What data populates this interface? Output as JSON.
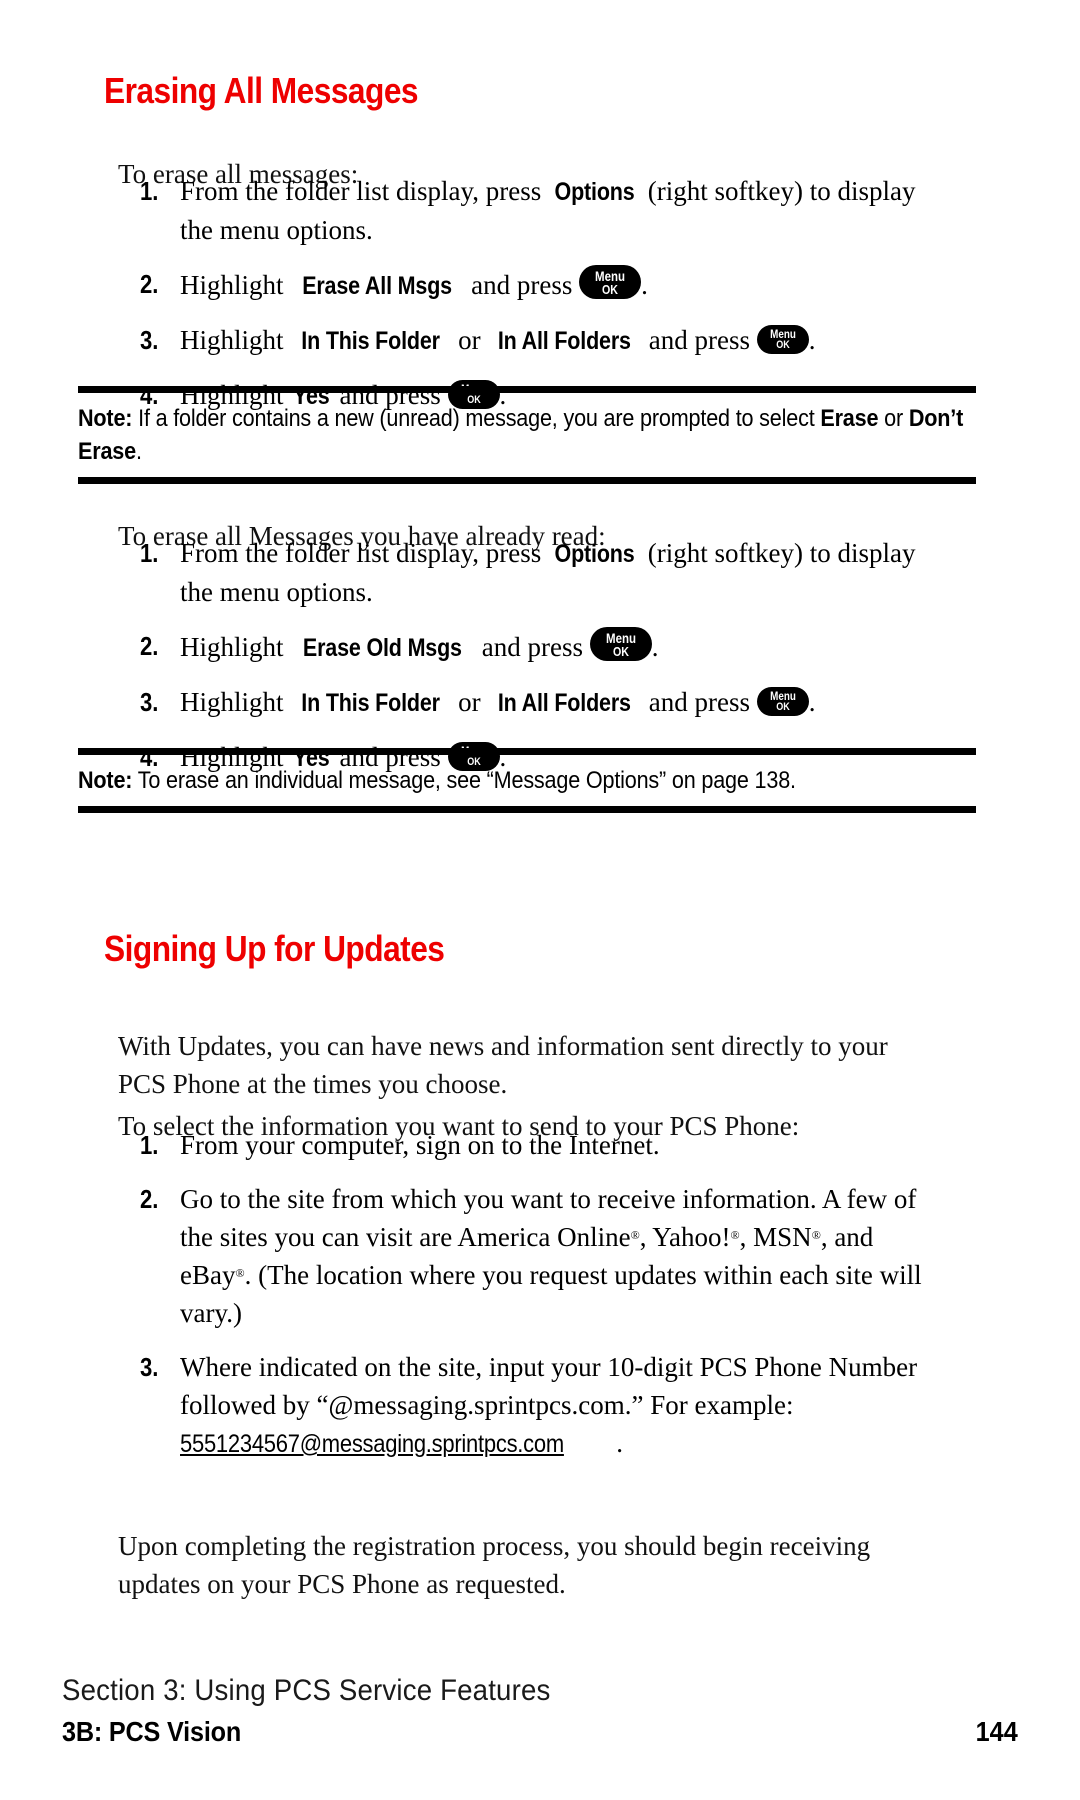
{
  "document": {
    "page_number": "144",
    "accent_color": "#ee0000",
    "text_color": "#000000"
  },
  "sections": [
    {
      "heading": "Erasing All Messages",
      "lead": "To erase all messages:",
      "steps": [
        {
          "number": "1.",
          "parts": [
            {
              "type": "text",
              "value": "From the folder list display, press "
            },
            {
              "type": "ui",
              "value": "Options"
            },
            {
              "type": "text",
              "value": " (right softkey) to display the menu options."
            }
          ]
        },
        {
          "number": "2.",
          "parts": [
            {
              "type": "text",
              "value": "Highlight "
            },
            {
              "type": "ui",
              "value": "Erase All Msgs"
            },
            {
              "type": "text",
              "value": " and press "
            },
            {
              "type": "key",
              "top": "Menu",
              "bottom": "OK",
              "size": "big"
            },
            {
              "type": "text",
              "value": "."
            }
          ]
        },
        {
          "number": "3.",
          "parts": [
            {
              "type": "text",
              "value": "Highlight "
            },
            {
              "type": "ui",
              "value": "In This Folder"
            },
            {
              "type": "text",
              "value": " or "
            },
            {
              "type": "ui",
              "value": "In All Folders"
            },
            {
              "type": "text",
              "value": " and press "
            },
            {
              "type": "key",
              "top": "Menu",
              "bottom": "OK",
              "size": "small"
            },
            {
              "type": "text",
              "value": "."
            }
          ]
        },
        {
          "number": "4.",
          "parts": [
            {
              "type": "text",
              "value": "Highlight "
            },
            {
              "type": "ui",
              "value": "Yes"
            },
            {
              "type": "text",
              "value": " and press "
            },
            {
              "type": "key",
              "top": "Menu",
              "bottom": "OK",
              "size": "small"
            },
            {
              "type": "text",
              "value": "."
            }
          ]
        }
      ]
    }
  ],
  "note_1": {
    "label": "Note:",
    "parts": [
      {
        "type": "bold",
        "value": "Note:"
      },
      {
        "type": "text",
        "value": " If a folder contains a new (unread) message, you are prompted to select "
      },
      {
        "type": "bold",
        "value": "Erase"
      },
      {
        "type": "text",
        "value": " or "
      },
      {
        "type": "bold",
        "value": "Don’t Erase"
      },
      {
        "type": "text",
        "value": "."
      }
    ]
  },
  "second_procedure": {
    "lead": "To erase all Messages you have already read:",
    "steps": [
      {
        "number": "1.",
        "parts": [
          {
            "type": "text",
            "value": "From the folder list display, press "
          },
          {
            "type": "ui",
            "value": "Options"
          },
          {
            "type": "text",
            "value": " (right softkey) to display the menu options."
          }
        ]
      },
      {
        "number": "2.",
        "parts": [
          {
            "type": "text",
            "value": "Highlight "
          },
          {
            "type": "ui",
            "value": "Erase Old Msgs"
          },
          {
            "type": "text",
            "value": " and press "
          },
          {
            "type": "key",
            "top": "Menu",
            "bottom": "OK",
            "size": "big"
          },
          {
            "type": "text",
            "value": "."
          }
        ]
      },
      {
        "number": "3.",
        "parts": [
          {
            "type": "text",
            "value": "Highlight "
          },
          {
            "type": "ui",
            "value": "In This Folder"
          },
          {
            "type": "text",
            "value": " or "
          },
          {
            "type": "ui",
            "value": "In All Folders"
          },
          {
            "type": "text",
            "value": " and press "
          },
          {
            "type": "key",
            "top": "Menu",
            "bottom": "OK",
            "size": "small"
          },
          {
            "type": "text",
            "value": "."
          }
        ]
      },
      {
        "number": "4.",
        "parts": [
          {
            "type": "text",
            "value": "Highlight "
          },
          {
            "type": "ui",
            "value": "Yes"
          },
          {
            "type": "text",
            "value": " and press "
          },
          {
            "type": "key",
            "top": "Menu",
            "bottom": "OK",
            "size": "small"
          },
          {
            "type": "text",
            "value": "."
          }
        ]
      }
    ]
  },
  "note_2": {
    "parts": [
      {
        "type": "bold",
        "value": "Note:"
      },
      {
        "type": "text",
        "value": " To erase an individual message, see “Message Options” on page 138."
      }
    ]
  },
  "updates_section": {
    "heading": "Signing Up for Updates",
    "intro": "With Updates, you can have news and information sent directly to your PCS Phone at the times you choose.",
    "lead": "To select the information you want to send to your PCS Phone:",
    "steps": [
      {
        "number": "1.",
        "parts": [
          {
            "type": "text",
            "value": "From your computer, sign on to the Internet."
          }
        ]
      },
      {
        "number": "2.",
        "parts": [
          {
            "type": "text",
            "value": "Go to the site from which you want to receive information. A few of the sites you can visit are America Online"
          },
          {
            "type": "reg",
            "value": "®"
          },
          {
            "type": "text",
            "value": ", Yahoo!"
          },
          {
            "type": "reg",
            "value": "®"
          },
          {
            "type": "text",
            "value": ", MSN"
          },
          {
            "type": "reg",
            "value": "®"
          },
          {
            "type": "text",
            "value": ", and eBay"
          },
          {
            "type": "reg",
            "value": "®"
          },
          {
            "type": "text",
            "value": ". (The location where you request updates within each site will vary.)"
          }
        ]
      },
      {
        "number": "3.",
        "parts": [
          {
            "type": "text",
            "value": "Where indicated on the site, input your 10-digit PCS Phone Number followed by “@messaging.sprintpcs.com.” For example: "
          },
          {
            "type": "email",
            "value": "5551234567@messaging.sprintpcs.com"
          },
          {
            "type": "text",
            "value": "."
          }
        ]
      }
    ],
    "closing": "Upon completing the registration process, you should begin receiving updates on your PCS Phone as requested."
  },
  "footer": {
    "section_label": "Section 3: Using PCS Service Features",
    "chapter_label": "3B: PCS Vision",
    "page_number": "144"
  }
}
